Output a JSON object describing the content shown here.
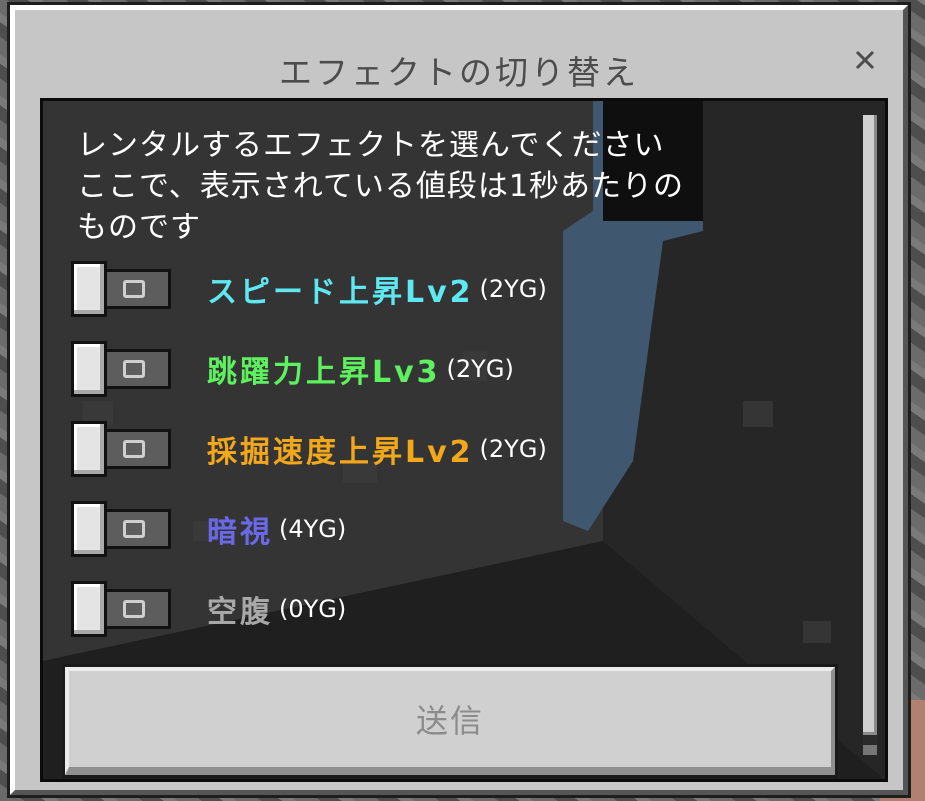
{
  "dialog": {
    "title": "エフェクトの切り替え",
    "close_icon": "close-icon",
    "description_lines": [
      "レンタルするエフェクトを選んでください",
      "ここで、表示されている値段は1秒あたりの",
      "ものです"
    ],
    "effects": [
      {
        "name": "スピード上昇Lv2",
        "price": "(2YG)",
        "color": "#5ee8f2",
        "enabled": false
      },
      {
        "name": "跳躍力上昇Lv3",
        "price": "(2YG)",
        "color": "#5ef05e",
        "enabled": false
      },
      {
        "name": "採掘速度上昇Lv2",
        "price": "(2YG)",
        "color": "#f2a81a",
        "enabled": false
      },
      {
        "name": "暗視",
        "price": "(4YG)",
        "color": "#6a6ae8",
        "enabled": false
      },
      {
        "name": "空腹",
        "price": "(0YG)",
        "color": "#a8a8a8",
        "enabled": false
      }
    ],
    "submit_label": "送信"
  }
}
